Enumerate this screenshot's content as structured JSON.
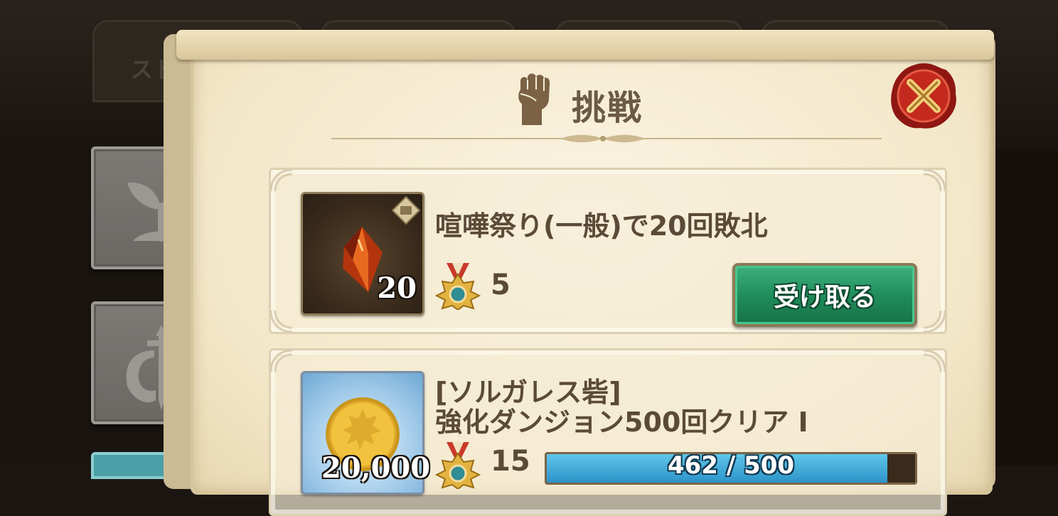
{
  "header": {
    "title": "挑戦"
  },
  "background": {
    "tab_label": "スト"
  },
  "missions": [
    {
      "description": "喧嘩祭り(一般)で20回敗北",
      "reward_count": "20",
      "medal_count": "5",
      "claim_label": "受け取る",
      "reward_icon": "fire-crystal-icon"
    },
    {
      "description_line1": "[ソルガレス砦]",
      "description_line2": "強化ダンジョン500回クリア I",
      "reward_count": "20,000",
      "medal_count": "15",
      "progress_text": "462 / 500",
      "progress_fraction": 0.924,
      "reward_icon": "gold-coin-icon"
    }
  ],
  "side_tabs": [
    {
      "icon": "sprout-icon"
    },
    {
      "icon": "winged-sword-icon"
    }
  ],
  "colors": {
    "parchment": "#f3e7c9",
    "text_brown": "#5b4a37",
    "claim_green": "#1f8a5a",
    "close_red": "#b3221b",
    "progress_blue": "#2c93c9"
  }
}
